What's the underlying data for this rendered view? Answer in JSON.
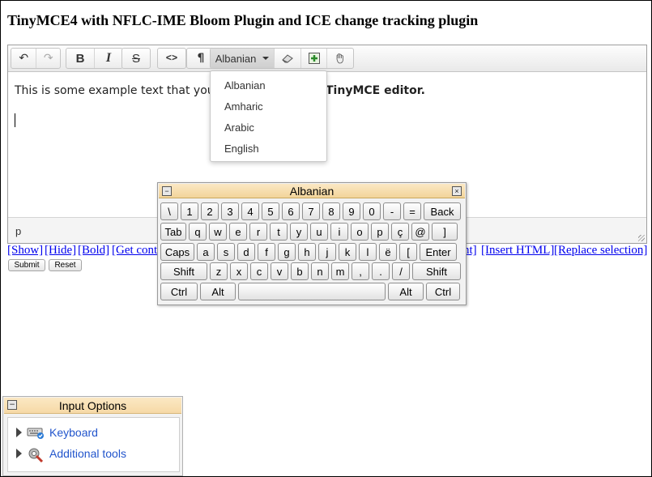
{
  "page": {
    "title": "TinyMCE4 with NFLC-IME Bloom Plugin and ICE change tracking plugin"
  },
  "toolbar": {
    "undo_icon": "↶",
    "redo_icon": "↷",
    "bold_label": "B",
    "italic_label": "I",
    "strike_label": "S",
    "code_label": "<>",
    "paragraph_label": "¶",
    "language_selected": "Albanian",
    "icons": [
      "undo-icon",
      "redo-icon",
      "bold-icon",
      "italic-icon",
      "strikethrough-icon",
      "code-icon",
      "paragraph-icon",
      "eraser-icon",
      "insert-image-icon",
      "hand-icon"
    ]
  },
  "language_dropdown": {
    "options": [
      "Albanian",
      "Amharic",
      "Arabic",
      "English"
    ]
  },
  "editor": {
    "text_start": "This is some example text that you",
    "text_end": "TinyMCE editor.",
    "status_path": "p"
  },
  "links": {
    "show": "[Show]",
    "hide": "[Hide]",
    "bold": "[Bold]",
    "get_content": "[Get conte",
    "end_fragment": "nt]",
    "insert_html": "[Insert HTML]",
    "replace_selection": "[Replace selection]"
  },
  "form": {
    "submit": "Submit",
    "reset": "Reset"
  },
  "virtual_keyboard": {
    "title": "Albanian",
    "minimize": "−",
    "close": "×",
    "rows": [
      [
        "\\",
        "1",
        "2",
        "3",
        "4",
        "5",
        "6",
        "7",
        "8",
        "9",
        "0",
        "-",
        "=",
        "Back"
      ],
      [
        "Tab",
        "q",
        "w",
        "e",
        "r",
        "t",
        "y",
        "u",
        "i",
        "o",
        "p",
        "ç",
        "@",
        "]"
      ],
      [
        "Caps",
        "a",
        "s",
        "d",
        "f",
        "g",
        "h",
        "j",
        "k",
        "l",
        "ë",
        "[",
        "Enter"
      ],
      [
        "Shift",
        "z",
        "x",
        "c",
        "v",
        "b",
        "n",
        "m",
        ",",
        ".",
        "/",
        "Shift"
      ],
      [
        "Ctrl",
        "Alt",
        "",
        "Alt",
        "Ctrl"
      ]
    ]
  },
  "input_options": {
    "title": "Input Options",
    "collapse_icon": "−",
    "items": [
      {
        "label": "Keyboard",
        "icon": "keyboard-icon"
      },
      {
        "label": "Additional tools",
        "icon": "tools-icon"
      }
    ]
  }
}
